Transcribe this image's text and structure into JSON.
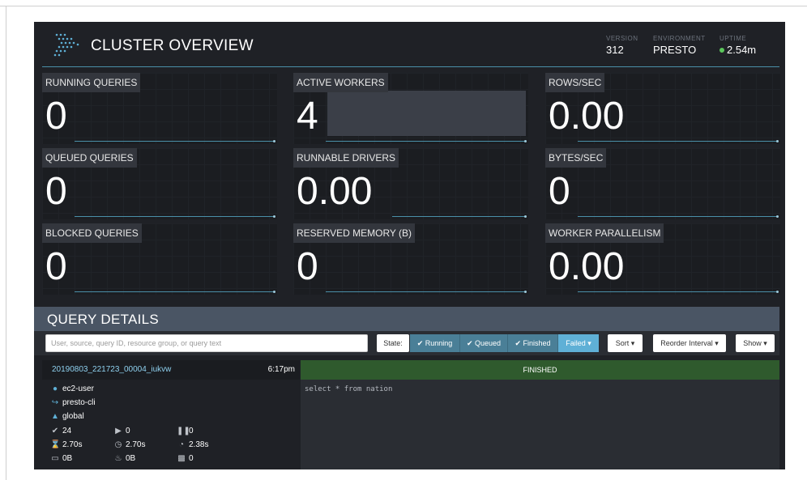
{
  "header": {
    "title": "CLUSTER OVERVIEW",
    "version_label": "VERSION",
    "version_value": "312",
    "environment_label": "ENVIRONMENT",
    "environment_value": "PRESTO",
    "uptime_label": "UPTIME",
    "uptime_value": "2.54m"
  },
  "tiles": [
    {
      "label": "RUNNING QUERIES",
      "value": "0"
    },
    {
      "label": "ACTIVE WORKERS",
      "value": "4"
    },
    {
      "label": "ROWS/SEC",
      "value": "0.00"
    },
    {
      "label": "QUEUED QUERIES",
      "value": "0"
    },
    {
      "label": "RUNNABLE DRIVERS",
      "value": "0.00"
    },
    {
      "label": "BYTES/SEC",
      "value": "0"
    },
    {
      "label": "BLOCKED QUERIES",
      "value": "0"
    },
    {
      "label": "RESERVED MEMORY (B)",
      "value": "0"
    },
    {
      "label": "WORKER PARALLELISM",
      "value": "0.00"
    }
  ],
  "details": {
    "title": "QUERY DETAILS",
    "search_placeholder": "User, source, query ID, resource group, or query text",
    "state_label": "State:",
    "filters": [
      "✔ Running",
      "✔ Queued",
      "✔ Finished",
      "Failed ▾"
    ],
    "sort_label": "Sort ▾",
    "reorder_label": "Reorder Interval ▾",
    "show_label": "Show ▾"
  },
  "query": {
    "id": "20190803_221723_00004_iukvw",
    "time": "6:17pm",
    "state": "FINISHED",
    "user": "ec2-user",
    "source": "presto-cli",
    "resource_group": "global",
    "completed_splits": "24",
    "running_splits": "0",
    "queued_splits": "0",
    "wall_time": "2.70s",
    "elapsed_time": "2.70s",
    "cpu_time": "2.38s",
    "memory": "0B",
    "peak_memory": "0B",
    "cumulative_memory": "0",
    "sql": "select * from nation"
  },
  "colors": {
    "background": "#1f2126",
    "accent": "#4a8fa8",
    "finished": "#2f5a2d",
    "uptime_dot": "#5bc65b"
  }
}
